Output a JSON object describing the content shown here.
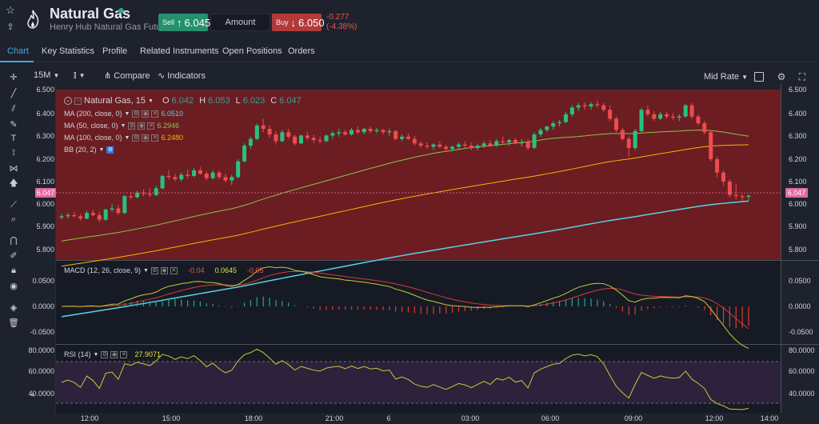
{
  "header": {
    "title": "Natural Gas",
    "subtitle": "Henry Hub Natural Gas Futures",
    "sell_label": "Sell",
    "sell_arrow": "↑",
    "sell_price": "6.045",
    "amount_label": "Amount",
    "buy_label": "Buy",
    "buy_arrow": "↓",
    "buy_price": "6.050",
    "change": "-0.277",
    "change_pct": "(-4.38%)",
    "status_color": "#26a69a"
  },
  "tabs": [
    {
      "label": "Chart",
      "active": true
    },
    {
      "label": "Key Statistics"
    },
    {
      "label": "Profile"
    },
    {
      "label": "Related Instruments"
    },
    {
      "label": "Open Positions"
    },
    {
      "label": "Orders"
    }
  ],
  "toolbar": {
    "interval": "15M",
    "compare": "Compare",
    "indicators": "Indicators",
    "mid_rate": "Mid Rate"
  },
  "icons": [
    "star-icon",
    "share-icon",
    "flame-logo-icon",
    "crosshair-icon",
    "line-tool-icon",
    "fib-tool-icon",
    "brush-icon",
    "text-icon",
    "pattern-icon",
    "arrow-icon",
    "measure-icon",
    "zoom-icon",
    "magnet-icon",
    "lock-icon",
    "eye-icon",
    "layers-icon",
    "trash-icon",
    "candle-type-icon",
    "square-icon",
    "settings-icon",
    "fullscreen-icon",
    "collapse-icon"
  ],
  "legend": {
    "symbol": "Natural Gas, 15",
    "o_label": "O",
    "o": "6.042",
    "h_label": "H",
    "h": "6.053",
    "l_label": "L",
    "l": "6.023",
    "c_label": "C",
    "c": "6.047"
  },
  "indicators": [
    {
      "label": "MA (200, close, 0)",
      "value": "6.0510",
      "color": "#5bd0e8"
    },
    {
      "label": "MA (50, close, 0)",
      "value": "6.2946",
      "color": "#8bc34a"
    },
    {
      "label": "MA (100, close, 0)",
      "value": "6.2480",
      "color": "#ffb300"
    },
    {
      "label": "BB (20, 2)",
      "value": "",
      "color": "#d1d4dc"
    }
  ],
  "macd": {
    "label": "MACD (12, 26, close, 9)",
    "value": "0.0645",
    "v1": "-0.04",
    "v2": "-0.05"
  },
  "rsi": {
    "label": "RSI (14)",
    "value": "27.9071"
  },
  "price_axis": [
    "6.500",
    "6.400",
    "6.300",
    "6.200",
    "6.100",
    "6.000",
    "5.900",
    "5.800"
  ],
  "macd_axis": [
    "0.0500",
    "0.0000",
    "-0.0500"
  ],
  "rsi_axis": [
    "80.0000",
    "60.0000",
    "40.0000"
  ],
  "last_price": "6.047",
  "time_axis": [
    "12:00",
    "15:00",
    "18:00",
    "21:00",
    "6",
    "03:00",
    "06:00",
    "09:00",
    "12:00",
    "14:00"
  ],
  "chart_data": {
    "type": "candlestick",
    "symbol": "Natural Gas",
    "interval": "15",
    "ylim": [
      5.76,
      6.52
    ],
    "ohlc": [
      [
        5.95,
        5.965,
        5.94,
        5.955
      ],
      [
        5.955,
        5.97,
        5.945,
        5.96
      ],
      [
        5.96,
        5.975,
        5.95,
        5.955
      ],
      [
        5.955,
        5.965,
        5.935,
        5.945
      ],
      [
        5.945,
        5.98,
        5.94,
        5.97
      ],
      [
        5.97,
        5.985,
        5.955,
        5.96
      ],
      [
        5.96,
        5.975,
        5.93,
        5.94
      ],
      [
        5.94,
        5.99,
        5.935,
        5.985
      ],
      [
        5.985,
        6.01,
        5.975,
        5.99
      ],
      [
        5.99,
        6.005,
        5.96,
        5.97
      ],
      [
        5.97,
        6.05,
        5.965,
        6.045
      ],
      [
        6.045,
        6.065,
        6.03,
        6.04
      ],
      [
        6.04,
        6.07,
        6.035,
        6.06
      ],
      [
        6.06,
        6.075,
        6.045,
        6.055
      ],
      [
        6.055,
        6.08,
        6.04,
        6.05
      ],
      [
        6.05,
        6.09,
        6.045,
        6.08
      ],
      [
        6.08,
        6.14,
        6.075,
        6.135
      ],
      [
        6.135,
        6.16,
        6.12,
        6.13
      ],
      [
        6.13,
        6.145,
        6.11,
        6.12
      ],
      [
        6.12,
        6.15,
        6.11,
        6.14
      ],
      [
        6.14,
        6.165,
        6.125,
        6.135
      ],
      [
        6.135,
        6.17,
        6.13,
        6.16
      ],
      [
        6.16,
        6.175,
        6.14,
        6.145
      ],
      [
        6.145,
        6.155,
        6.115,
        6.125
      ],
      [
        6.125,
        6.16,
        6.12,
        6.15
      ],
      [
        6.15,
        6.16,
        6.12,
        6.13
      ],
      [
        6.13,
        6.145,
        6.105,
        6.115
      ],
      [
        6.115,
        6.14,
        6.095,
        6.13
      ],
      [
        6.13,
        6.21,
        6.125,
        6.2
      ],
      [
        6.2,
        6.28,
        6.195,
        6.27
      ],
      [
        6.27,
        6.31,
        6.255,
        6.3
      ],
      [
        6.3,
        6.37,
        6.295,
        6.36
      ],
      [
        6.36,
        6.39,
        6.33,
        6.345
      ],
      [
        6.345,
        6.36,
        6.305,
        6.32
      ],
      [
        6.32,
        6.335,
        6.275,
        6.29
      ],
      [
        6.29,
        6.34,
        6.285,
        6.33
      ],
      [
        6.33,
        6.345,
        6.3,
        6.31
      ],
      [
        6.31,
        6.32,
        6.27,
        6.28
      ],
      [
        6.28,
        6.32,
        6.275,
        6.315
      ],
      [
        6.315,
        6.33,
        6.295,
        6.305
      ],
      [
        6.305,
        6.32,
        6.28,
        6.295
      ],
      [
        6.295,
        6.31,
        6.28,
        6.29
      ],
      [
        6.29,
        6.32,
        6.285,
        6.315
      ],
      [
        6.315,
        6.335,
        6.3,
        6.325
      ],
      [
        6.325,
        6.345,
        6.31,
        6.33
      ],
      [
        6.33,
        6.34,
        6.315,
        6.32
      ],
      [
        6.32,
        6.35,
        6.315,
        6.34
      ],
      [
        6.34,
        6.355,
        6.32,
        6.33
      ],
      [
        6.33,
        6.35,
        6.32,
        6.345
      ],
      [
        6.345,
        6.355,
        6.325,
        6.335
      ],
      [
        6.335,
        6.35,
        6.325,
        6.34
      ],
      [
        6.34,
        6.345,
        6.32,
        6.33
      ],
      [
        6.33,
        6.345,
        6.315,
        6.335
      ],
      [
        6.335,
        6.34,
        6.295,
        6.3
      ],
      [
        6.3,
        6.32,
        6.29,
        6.31
      ],
      [
        6.31,
        6.325,
        6.295,
        6.3
      ],
      [
        6.3,
        6.315,
        6.27,
        6.28
      ],
      [
        6.28,
        6.29,
        6.26,
        6.27
      ],
      [
        6.27,
        6.285,
        6.255,
        6.265
      ],
      [
        6.265,
        6.28,
        6.25,
        6.275
      ],
      [
        6.275,
        6.29,
        6.26,
        6.265
      ],
      [
        6.265,
        6.275,
        6.245,
        6.255
      ],
      [
        6.255,
        6.27,
        6.245,
        6.265
      ],
      [
        6.265,
        6.285,
        6.255,
        6.275
      ],
      [
        6.275,
        6.29,
        6.26,
        6.27
      ],
      [
        6.27,
        6.285,
        6.25,
        6.26
      ],
      [
        6.26,
        6.28,
        6.25,
        6.27
      ],
      [
        6.27,
        6.29,
        6.26,
        6.28
      ],
      [
        6.28,
        6.295,
        6.265,
        6.27
      ],
      [
        6.27,
        6.3,
        6.265,
        6.29
      ],
      [
        6.29,
        6.31,
        6.275,
        6.285
      ],
      [
        6.285,
        6.3,
        6.27,
        6.295
      ],
      [
        6.295,
        6.305,
        6.275,
        6.28
      ],
      [
        6.28,
        6.3,
        6.265,
        6.285
      ],
      [
        6.285,
        6.3,
        6.25,
        6.26
      ],
      [
        6.26,
        6.33,
        6.255,
        6.32
      ],
      [
        6.32,
        6.35,
        6.31,
        6.34
      ],
      [
        6.34,
        6.36,
        6.33,
        6.355
      ],
      [
        6.355,
        6.38,
        6.34,
        6.37
      ],
      [
        6.37,
        6.385,
        6.355,
        6.375
      ],
      [
        6.375,
        6.42,
        6.37,
        6.41
      ],
      [
        6.41,
        6.45,
        6.4,
        6.44
      ],
      [
        6.44,
        6.46,
        6.425,
        6.45
      ],
      [
        6.45,
        6.465,
        6.43,
        6.445
      ],
      [
        6.445,
        6.465,
        6.43,
        6.455
      ],
      [
        6.455,
        6.47,
        6.44,
        6.45
      ],
      [
        6.45,
        6.46,
        6.42,
        6.43
      ],
      [
        6.43,
        6.45,
        6.38,
        6.39
      ],
      [
        6.39,
        6.4,
        6.33,
        6.34
      ],
      [
        6.34,
        6.35,
        6.29,
        6.3
      ],
      [
        6.3,
        6.31,
        6.22,
        6.26
      ],
      [
        6.26,
        6.345,
        6.25,
        6.335
      ],
      [
        6.335,
        6.44,
        6.33,
        6.43
      ],
      [
        6.43,
        6.45,
        6.4,
        6.41
      ],
      [
        6.41,
        6.425,
        6.38,
        6.39
      ],
      [
        6.39,
        6.42,
        6.385,
        6.41
      ],
      [
        6.41,
        6.42,
        6.39,
        6.4
      ],
      [
        6.4,
        6.415,
        6.385,
        6.395
      ],
      [
        6.395,
        6.41,
        6.38,
        6.4
      ],
      [
        6.4,
        6.455,
        6.395,
        6.45
      ],
      [
        6.45,
        6.46,
        6.39,
        6.4
      ],
      [
        6.4,
        6.41,
        6.36,
        6.37
      ],
      [
        6.37,
        6.38,
        6.32,
        6.33
      ],
      [
        6.33,
        6.34,
        6.2,
        6.21
      ],
      [
        6.21,
        6.22,
        6.13,
        6.15
      ],
      [
        6.15,
        6.16,
        6.09,
        6.11
      ],
      [
        6.11,
        6.12,
        6.04,
        6.05
      ],
      [
        6.05,
        6.1,
        6.03,
        6.045
      ],
      [
        6.045,
        6.055,
        6.025,
        6.04
      ],
      [
        6.042,
        6.053,
        6.023,
        6.047
      ]
    ]
  }
}
